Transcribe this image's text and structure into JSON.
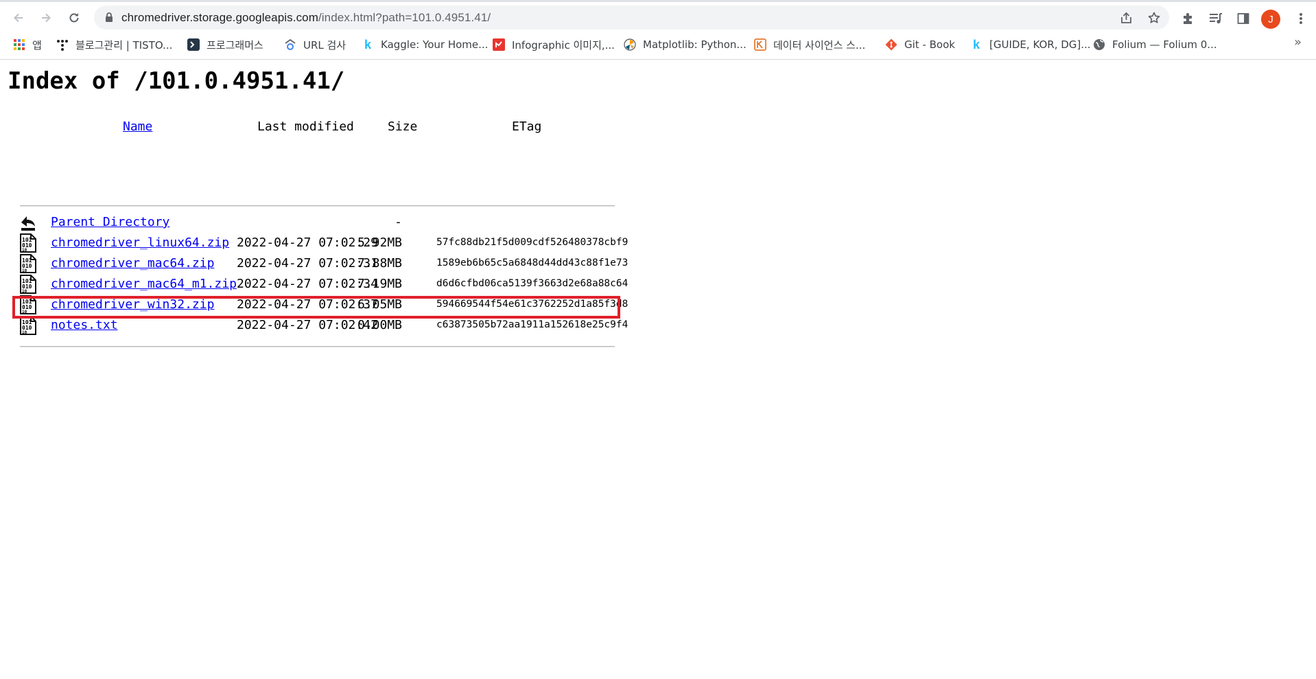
{
  "browser": {
    "url_host": "chromedriver.storage.googleapis.com",
    "url_rest": "/index.html?path=101.0.4951.41/",
    "avatar_letter": "J",
    "accent_color": "#e8491d"
  },
  "bookmarks": [
    {
      "label": "앱",
      "icon": "apps-grid-icon"
    },
    {
      "label": "블로그관리 | TISTO...",
      "icon": "tistory-icon"
    },
    {
      "label": "프로그래머스",
      "icon": "programmers-icon"
    },
    {
      "label": "URL 검사",
      "icon": "url-check-icon"
    },
    {
      "label": "Kaggle: Your Home...",
      "icon": "kaggle-icon"
    },
    {
      "label": "Infographic 이미지,...",
      "icon": "infographic-icon"
    },
    {
      "label": "Matplotlib: Python...",
      "icon": "matplotlib-icon"
    },
    {
      "label": "데이터 사이언스 스...",
      "icon": "data-science-icon"
    },
    {
      "label": "Git - Book",
      "icon": "git-icon"
    },
    {
      "label": "[GUIDE, KOR, DG]...",
      "icon": "kaggle-icon"
    },
    {
      "label": "Folium — Folium 0...",
      "icon": "globe-icon"
    }
  ],
  "bookmarks_overflow": "»",
  "page": {
    "title": "Index of /101.0.4951.41/",
    "headers": {
      "name": "Name",
      "modified": "Last modified",
      "size": "Size",
      "etag": "ETag"
    },
    "parent": {
      "name": "Parent Directory",
      "size": "-"
    },
    "files": [
      {
        "name": "chromedriver_linux64.zip",
        "modified": "2022-04-27 07:02:29",
        "size": "5.92MB",
        "etag": "57fc88db21f5d009cdf526480378cbf9"
      },
      {
        "name": "chromedriver_mac64.zip",
        "modified": "2022-04-27 07:02:31",
        "size": "7.88MB",
        "etag": "1589eb6b65c5a6848d44dd43c88f1e73"
      },
      {
        "name": "chromedriver_mac64_m1.zip",
        "modified": "2022-04-27 07:02:34",
        "size": "7.19MB",
        "etag": "d6d6cfbd06ca5139f3663d2e68a88c64"
      },
      {
        "name": "chromedriver_win32.zip",
        "modified": "2022-04-27 07:02:37",
        "size": "6.05MB",
        "etag": "594669544f54e61c3762252d1a85f3d8"
      },
      {
        "name": "notes.txt",
        "modified": "2022-04-27 07:02:42",
        "size": "0.00MB",
        "etag": "c63873505b72aa1911a152618e25c9f4"
      }
    ],
    "highlight_color": "#e0202a"
  }
}
